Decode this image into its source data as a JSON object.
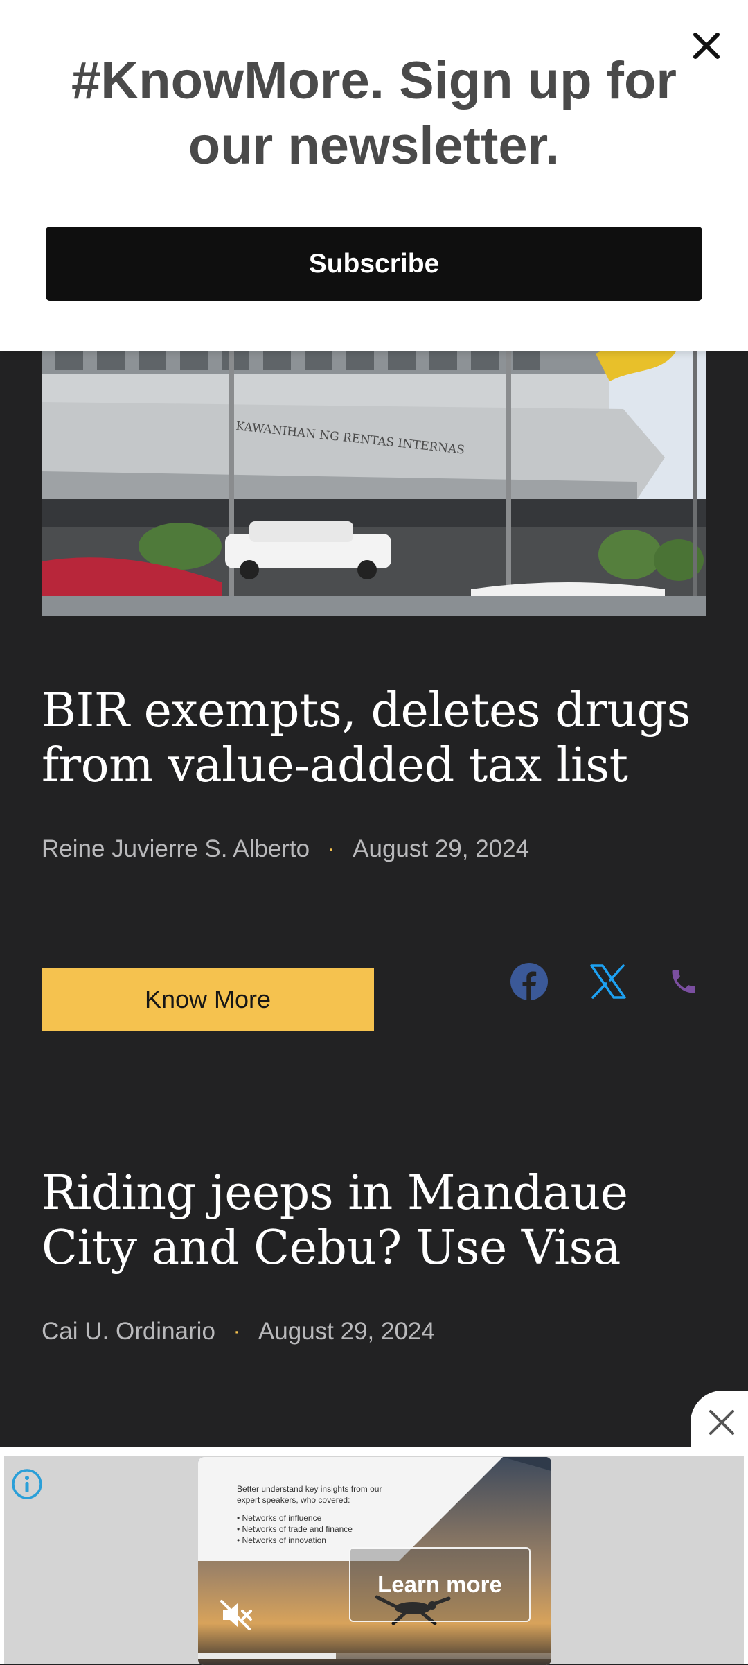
{
  "newsletter": {
    "heading": "#KnowMore. Sign up for our newsletter.",
    "subscribe_label": "Subscribe",
    "close_icon": "close-icon"
  },
  "articles": [
    {
      "title": "BIR exempts, deletes drugs from value-added tax list",
      "author": "Reine Juvierre S. Alberto",
      "separator": "·",
      "date": "August 29, 2024",
      "image": "bir-building-photo",
      "image_sign": "KAWANIHAN NG RENTAS INTERNAS"
    },
    {
      "title": "Riding jeeps in Mandaue City and Cebu? Use Visa",
      "author": "Cai U. Ordinario",
      "separator": "·",
      "date": "August 29, 2024"
    }
  ],
  "know_more_label": "Know More",
  "share": {
    "icons": [
      "facebook-icon",
      "x-icon",
      "phone-icon"
    ],
    "facebook_color": "#3b5998",
    "x_color": "#1da1f2",
    "phone_color": "#7b4fa0"
  },
  "ad": {
    "intro": "Better understand key insights from our expert speakers, who covered:",
    "bullets": [
      "Networks of influence",
      "Networks of trade and finance",
      "Networks of innovation"
    ],
    "learn_more_label": "Learn more",
    "progress": 0.39,
    "icons": [
      "info-icon",
      "mute-icon",
      "ad-close-icon"
    ]
  },
  "colors": {
    "background": "#222223",
    "accent": "#f5c24f",
    "subscribe_button": "#0f0f0f"
  }
}
